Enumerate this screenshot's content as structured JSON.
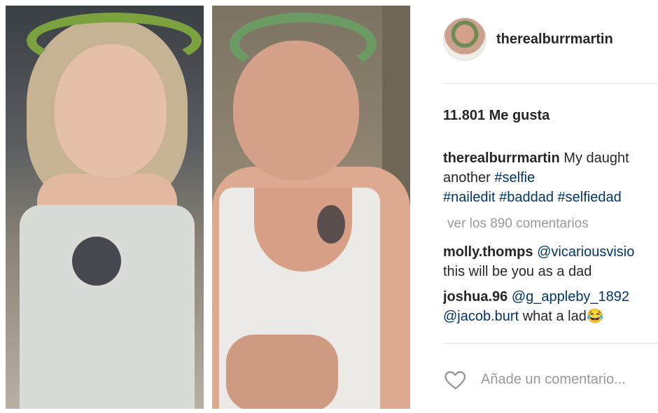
{
  "post": {
    "username": "therealburrmartin",
    "likes": "11.801 Me gusta",
    "caption": {
      "username": "therealburrmartin",
      "text_line1": "My daught",
      "text_line2_plain": "another ",
      "hashtag_selfie": "#selfie",
      "hashtags": [
        "#nailedit",
        "#baddad",
        "#selfiedad"
      ]
    },
    "view_all_comments": "ver los 890 comentarios",
    "comments": [
      {
        "username": "molly.thomps",
        "mention": "@vicariousvisio",
        "text": "this will be you as a dad"
      },
      {
        "username": "joshua.96",
        "mention": "@g_appleby_1892",
        "mention2": "@jacob.burt",
        "text": " what a lad",
        "emoji": "😂"
      }
    ],
    "add_comment_placeholder": "Añade un comentario..."
  },
  "icons": {
    "like": "heart-outline-icon"
  },
  "colors": {
    "link": "#003569",
    "muted": "#999999",
    "text": "#262626"
  }
}
